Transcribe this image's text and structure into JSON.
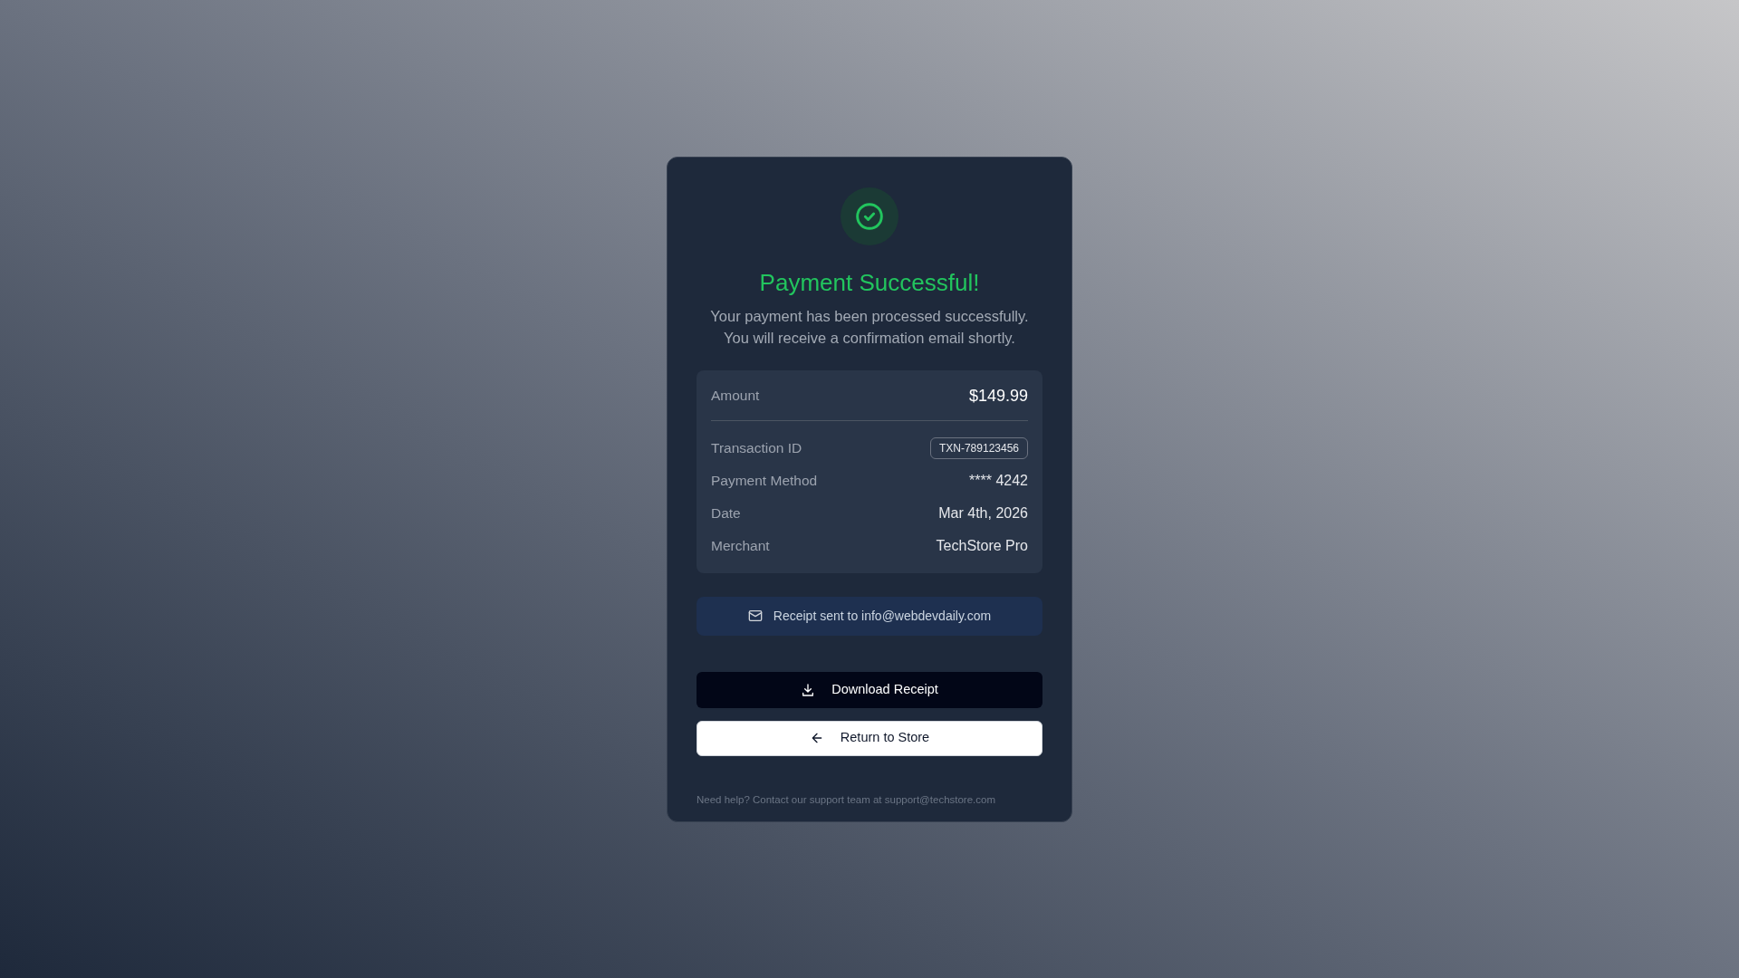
{
  "title": "Payment Successful!",
  "message": "Your payment has been processed successfully. You will receive a confirmation email shortly.",
  "details": [
    {
      "kind": "total",
      "label": "Amount",
      "value": "$149.99"
    },
    {
      "kind": "badge",
      "label": "Transaction ID",
      "value": "TXN-789123456"
    },
    {
      "kind": "text",
      "label": "Payment Method",
      "value": "**** 4242"
    },
    {
      "kind": "text",
      "label": "Date",
      "value": "Mar 4th, 2026"
    },
    {
      "kind": "text",
      "label": "Merchant",
      "value": "TechStore Pro"
    }
  ],
  "notice": "Receipt sent to info@webdevdaily.com",
  "buttons": [
    {
      "kind": "primary",
      "label": "Download Receipt"
    },
    {
      "kind": "secondary",
      "label": "Return to Store"
    }
  ],
  "footer": "Need help? Contact our support team at support@techstore.com"
}
